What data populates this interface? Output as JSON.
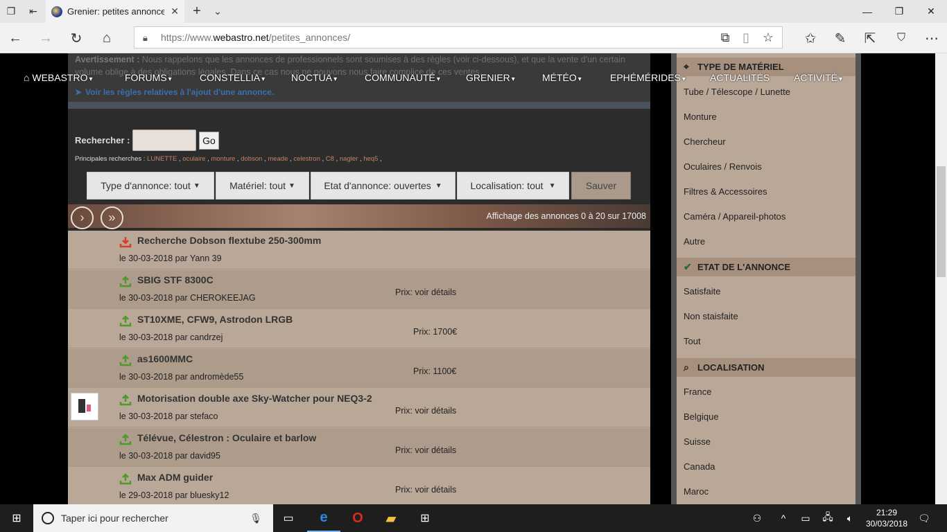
{
  "browser": {
    "tab_title": "Grenier: petites annonce",
    "url_prefix": "https://www.",
    "url_domain": "webastro.net",
    "url_path": "/petites_annonces/"
  },
  "menu": [
    {
      "label": "WEBASTRO",
      "caret": "▾"
    },
    {
      "label": "FORUMS",
      "caret": "▾"
    },
    {
      "label": "CONSTELLIA",
      "caret": "▾"
    },
    {
      "label": "NOCTUA",
      "caret": "▾"
    },
    {
      "label": "COMMUNAUTÉ",
      "caret": "▾"
    },
    {
      "label": "GRENIER",
      "caret": "▾"
    },
    {
      "label": "MÉTÉO",
      "caret": "▾"
    },
    {
      "label": "EPHÉMÉRIDES",
      "caret": "▾"
    },
    {
      "label": "ACTUALITÉS",
      "caret": ""
    },
    {
      "label": "ACTIVITÉ",
      "caret": "▾"
    }
  ],
  "notice": {
    "warning_label": "Avertissement :",
    "warning_text": " Nous rappelons que les annonces de professionnels sont soumises à des règles (voir ci-dessous), et que la vente d'un certain volume oblige à des obligations légales. Dans ce cas nous ne pouvons nous faire complice de ces ventes.",
    "rules_link": "Voir les règles relatives à l'ajout d'une annonce."
  },
  "search": {
    "label": "Rechercher :",
    "value": "",
    "go": "Go",
    "popular_label": "Principales recherches : ",
    "popular": [
      "LUNETTE",
      "oculaire",
      "monture",
      "dobson",
      "meade",
      "celestron",
      "C8",
      "nagler",
      "heq5"
    ]
  },
  "filters": {
    "type": "Type d'annonce: tout",
    "materiel": "Matériel: tout",
    "etat": "Etat d'annonce: ouvertes",
    "localisation": "Localisation: tout",
    "save": "Sauver"
  },
  "pager": {
    "count_text": "Affichage des annonces 0 à 20 sur 17008"
  },
  "listings": [
    {
      "title": "Recherche Dobson flextube 250-300mm",
      "meta": "le 30-03-2018 par Yann 39",
      "price": "",
      "kind": "wanted",
      "thumb": false
    },
    {
      "title": "SBIG STF 8300C",
      "meta": "le 30-03-2018 par CHEROKEEJAG",
      "price": "Prix: voir détails",
      "kind": "offer",
      "thumb": false
    },
    {
      "title": "ST10XME, CFW9, Astrodon LRGB",
      "meta": "le 30-03-2018 par candrzej",
      "price": "Prix: 1700€",
      "kind": "offer",
      "thumb": false
    },
    {
      "title": "as1600MMC",
      "meta": "le 30-03-2018 par andromède55",
      "price": "Prix: 1100€",
      "kind": "offer",
      "thumb": false
    },
    {
      "title": "Motorisation double axe Sky-Watcher pour NEQ3-2",
      "meta": "le 30-03-2018 par stefaco",
      "price": "Prix: voir détails",
      "kind": "offer",
      "thumb": true
    },
    {
      "title": "Télévue, Célestron : Oculaire et barlow",
      "meta": "le 30-03-2018 par david95",
      "price": "Prix: voir détails",
      "kind": "offer",
      "thumb": false
    },
    {
      "title": "Max ADM guider",
      "meta": "le 29-03-2018 par bluesky12",
      "price": "Prix: voir détails",
      "kind": "offer",
      "thumb": false
    }
  ],
  "sidebar": {
    "type_header": "TYPE DE MATÉRIEL",
    "type_items": [
      "Tube / Télescope / Lunette",
      "Monture",
      "Chercheur",
      "Oculaires / Renvois",
      "Filtres & Accessoires",
      "Caméra / Appareil-photos",
      "Autre"
    ],
    "etat_header": "ETAT DE L'ANNONCE",
    "etat_items": [
      "Satisfaite",
      "Non staisfaite",
      "Tout"
    ],
    "loc_header": "LOCALISATION",
    "loc_items": [
      "France",
      "Belgique",
      "Suisse",
      "Canada",
      "Maroc"
    ]
  },
  "taskbar": {
    "search_placeholder": "Taper ici pour rechercher",
    "time": "21:29",
    "date": "30/03/2018"
  },
  "colors": {
    "offer_arrow": "#4c9a2a",
    "wanted_arrow": "#d93a2a",
    "link": "#c28468",
    "listing_bg": "#b9a797"
  }
}
